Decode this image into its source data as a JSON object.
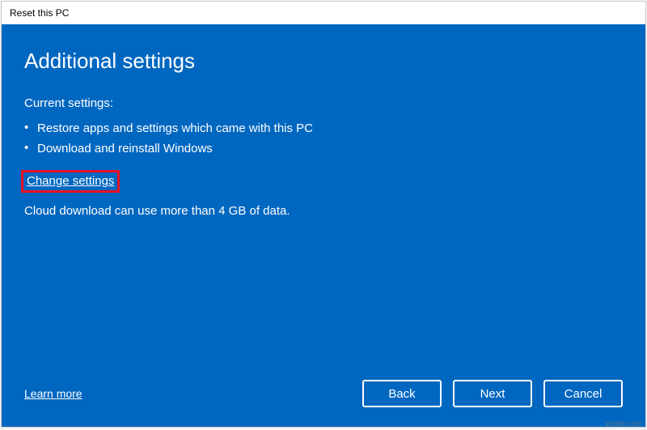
{
  "window": {
    "title": "Reset this PC"
  },
  "main": {
    "heading": "Additional settings",
    "current_settings_label": "Current settings:",
    "settings_items": [
      "Restore apps and settings which came with this PC",
      "Download and reinstall Windows"
    ],
    "change_settings_label": "Change settings",
    "note": "Cloud download can use more than 4 GB of data."
  },
  "footer": {
    "learn_more_label": "Learn more",
    "buttons": {
      "back": "Back",
      "next": "Next",
      "cancel": "Cancel"
    }
  },
  "watermark": "wsxdn.com"
}
